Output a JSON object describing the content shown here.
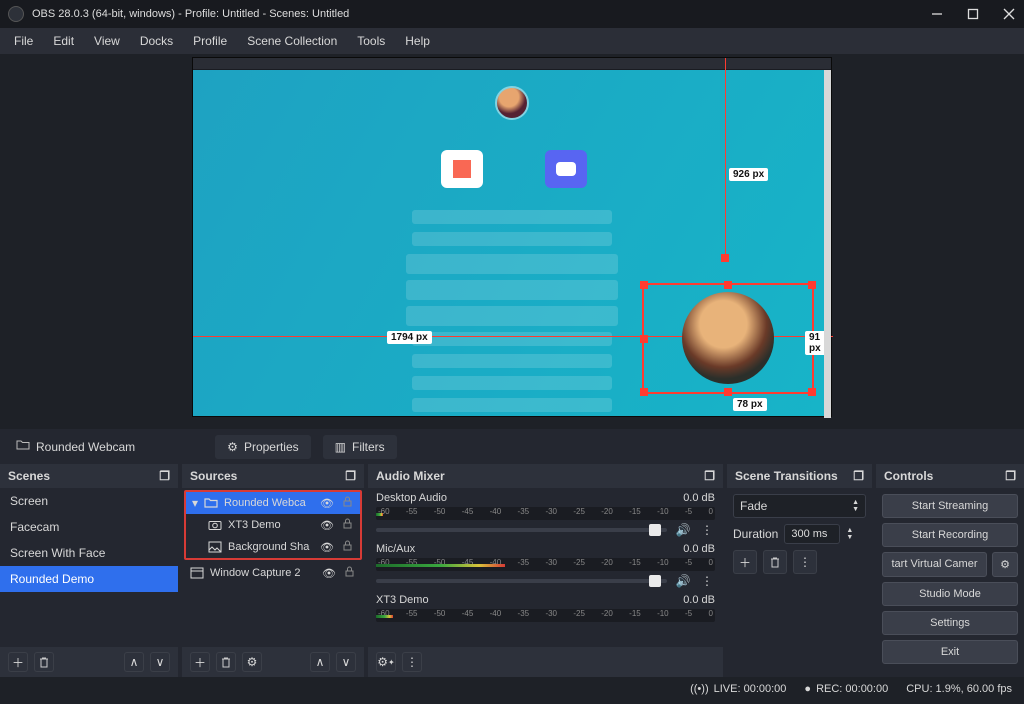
{
  "title": "OBS 28.0.3 (64-bit, windows) - Profile: Untitled - Scenes: Untitled",
  "menus": [
    "File",
    "Edit",
    "View",
    "Docks",
    "Profile",
    "Scene Collection",
    "Tools",
    "Help"
  ],
  "preview": {
    "dim_top": "926 px",
    "dim_left": "1794 px",
    "dim_right": "91 px",
    "dim_bottom": "78 px"
  },
  "toolbar": {
    "group_label": "Rounded Webcam",
    "properties": "Properties",
    "filters": "Filters"
  },
  "scenes": {
    "title": "Scenes",
    "items": [
      "Screen",
      "Facecam",
      "Screen With Face",
      "Rounded Demo"
    ],
    "selected": 3
  },
  "sources": {
    "title": "Sources",
    "items": [
      {
        "name": "Rounded Webca",
        "icon": "folder",
        "selected": true,
        "in_group": true,
        "chev": true
      },
      {
        "name": "XT3 Demo",
        "icon": "camera",
        "selected": false,
        "in_group": true,
        "chev": false
      },
      {
        "name": "Background Sha",
        "icon": "image",
        "selected": false,
        "in_group": true,
        "chev": false
      },
      {
        "name": "Window Capture 2",
        "icon": "window",
        "selected": false,
        "in_group": false,
        "chev": false
      }
    ]
  },
  "mixer": {
    "title": "Audio Mixer",
    "ticks": [
      "-60",
      "-55",
      "-50",
      "-45",
      "-40",
      "-35",
      "-30",
      "-25",
      "-20",
      "-15",
      "-10",
      "-5",
      "0"
    ],
    "channels": [
      {
        "name": "Desktop Audio",
        "db": "0.0 dB",
        "slider": 96,
        "fill": 2
      },
      {
        "name": "Mic/Aux",
        "db": "0.0 dB",
        "slider": 96,
        "fill": 38
      },
      {
        "name": "XT3 Demo",
        "db": "0.0 dB",
        "slider": 96,
        "fill": 5
      }
    ]
  },
  "transitions": {
    "title": "Scene Transitions",
    "selected": "Fade",
    "dur_label": "Duration",
    "dur_value": "300 ms"
  },
  "controls": {
    "title": "Controls",
    "buttons": [
      "Start Streaming",
      "Start Recording",
      "tart Virtual Camer",
      "Studio Mode",
      "Settings",
      "Exit"
    ]
  },
  "status": {
    "live": "LIVE: 00:00:00",
    "rec": "REC: 00:00:00",
    "cpu": "CPU: 1.9%, 60.00 fps"
  }
}
